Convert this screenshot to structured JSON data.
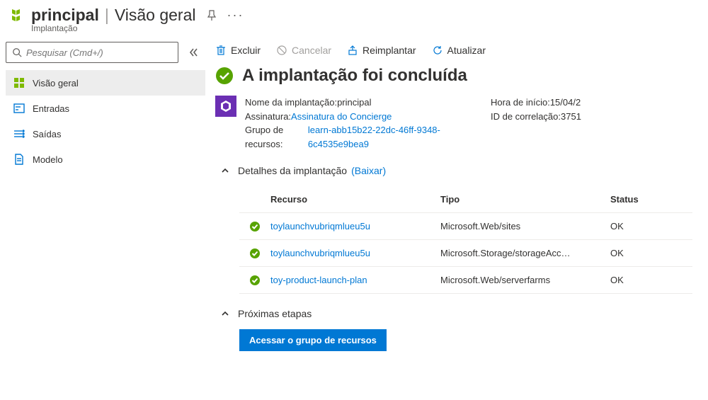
{
  "header": {
    "title": "principal",
    "subtitle": "Visão geral",
    "breadcrumb": "Implantação"
  },
  "search": {
    "placeholder": "Pesquisar (Cmd+/)"
  },
  "nav": {
    "items": [
      {
        "label": "Visão geral"
      },
      {
        "label": "Entradas"
      },
      {
        "label": "Saídas"
      },
      {
        "label": "Modelo"
      }
    ]
  },
  "toolbar": {
    "delete": "Excluir",
    "cancel": "Cancelar",
    "redeploy": "Reimplantar",
    "refresh": "Atualizar"
  },
  "status": {
    "title": "A implantação foi concluída"
  },
  "summary": {
    "deployment_name_label": "Nome da implantação: ",
    "deployment_name": "principal",
    "subscription_label": "Assinatura: ",
    "subscription": "Assinatura do Concierge",
    "resource_group_label": "Grupo de recursos: ",
    "resource_group": "learn-abb15b22-22dc-46ff-9348-6c4535e9bea9",
    "start_time_label": "Hora de início: ",
    "start_time": "15/04/2",
    "correlation_label": "ID de correlação: ",
    "correlation": "3751"
  },
  "details_section": {
    "label": "Detalhes da implantação",
    "download": "(Baixar)"
  },
  "table_headers": {
    "resource": "Recurso",
    "type": "Tipo",
    "status": "Status"
  },
  "rows": [
    {
      "resource": "toylaunchvubriqmlueu5u",
      "type": "Microsoft.Web/sites",
      "status": "OK"
    },
    {
      "resource": "toylaunchvubriqmlueu5u",
      "type": "Microsoft.Storage/storageAcc…",
      "status": "OK"
    },
    {
      "resource": "toy-product-launch-plan",
      "type": "Microsoft.Web/serverfarms",
      "status": "OK"
    }
  ],
  "next_steps": {
    "label": "Próximas etapas",
    "button": "Acessar o grupo de recursos"
  }
}
